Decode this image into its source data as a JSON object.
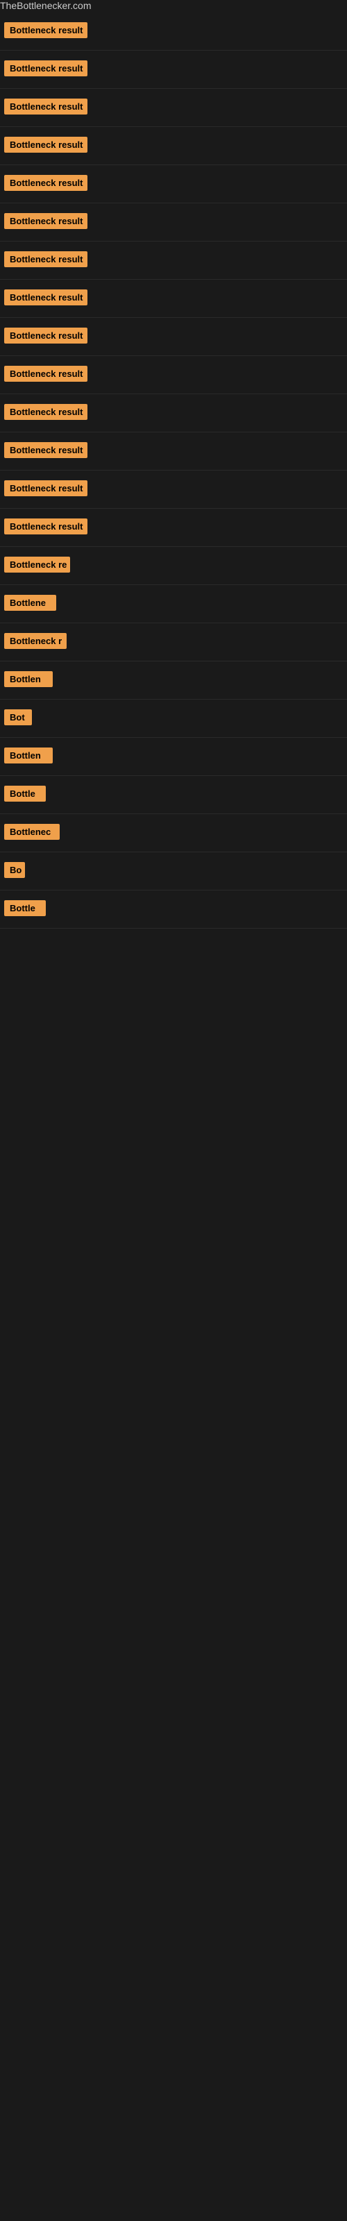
{
  "site": {
    "title": "TheBottlenecker.com"
  },
  "rows": [
    {
      "id": 1,
      "label": "Bottleneck result",
      "width": 120
    },
    {
      "id": 2,
      "label": "Bottleneck result",
      "width": 120
    },
    {
      "id": 3,
      "label": "Bottleneck result",
      "width": 120
    },
    {
      "id": 4,
      "label": "Bottleneck result",
      "width": 120
    },
    {
      "id": 5,
      "label": "Bottleneck result",
      "width": 120
    },
    {
      "id": 6,
      "label": "Bottleneck result",
      "width": 120
    },
    {
      "id": 7,
      "label": "Bottleneck result",
      "width": 120
    },
    {
      "id": 8,
      "label": "Bottleneck result",
      "width": 120
    },
    {
      "id": 9,
      "label": "Bottleneck result",
      "width": 120
    },
    {
      "id": 10,
      "label": "Bottleneck result",
      "width": 120
    },
    {
      "id": 11,
      "label": "Bottleneck result",
      "width": 120
    },
    {
      "id": 12,
      "label": "Bottleneck result",
      "width": 120
    },
    {
      "id": 13,
      "label": "Bottleneck result",
      "width": 120
    },
    {
      "id": 14,
      "label": "Bottleneck result",
      "width": 120
    },
    {
      "id": 15,
      "label": "Bottleneck re",
      "width": 95
    },
    {
      "id": 16,
      "label": "Bottlene",
      "width": 75
    },
    {
      "id": 17,
      "label": "Bottleneck r",
      "width": 90
    },
    {
      "id": 18,
      "label": "Bottlen",
      "width": 70
    },
    {
      "id": 19,
      "label": "Bot",
      "width": 40
    },
    {
      "id": 20,
      "label": "Bottlen",
      "width": 70
    },
    {
      "id": 21,
      "label": "Bottle",
      "width": 60
    },
    {
      "id": 22,
      "label": "Bottlenec",
      "width": 80
    },
    {
      "id": 23,
      "label": "Bo",
      "width": 30
    },
    {
      "id": 24,
      "label": "Bottle",
      "width": 60
    }
  ]
}
